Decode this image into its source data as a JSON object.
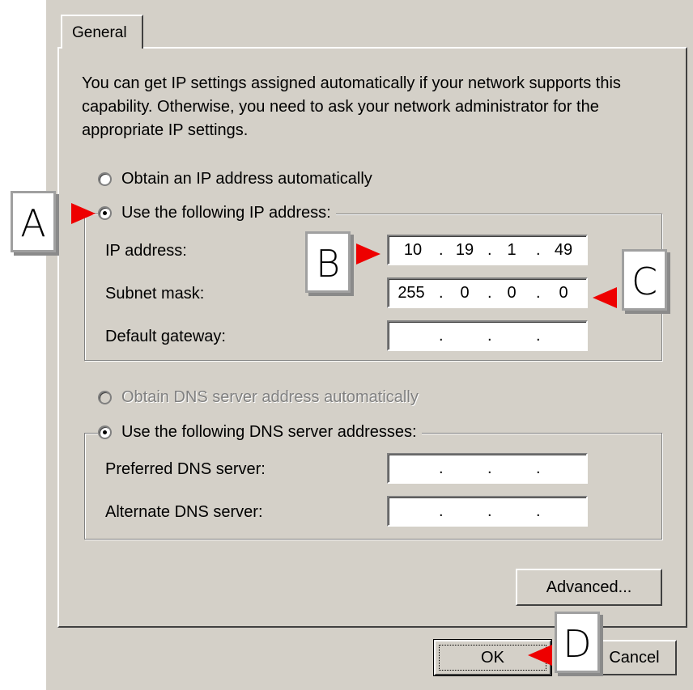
{
  "tab": {
    "label": "General"
  },
  "description": "You can get IP settings assigned automatically if your network supports this capability. Otherwise, you need to ask your network administrator for the appropriate IP settings.",
  "ip_section": {
    "auto_label": "Obtain an IP address automatically",
    "manual_label": "Use the following IP address:",
    "ip_label": "IP address:",
    "ip_value": [
      "10",
      "19",
      "1",
      "49"
    ],
    "subnet_label": "Subnet mask:",
    "subnet_value": [
      "255",
      "0",
      "0",
      "0"
    ],
    "gateway_label": "Default gateway:",
    "gateway_value": [
      "",
      "",
      "",
      ""
    ]
  },
  "dns_section": {
    "auto_label": "Obtain DNS server address automatically",
    "manual_label": "Use the following DNS server addresses:",
    "preferred_label": "Preferred DNS server:",
    "alternate_label": "Alternate DNS server:"
  },
  "buttons": {
    "advanced": "Advanced...",
    "ok": "OK",
    "cancel": "Cancel"
  },
  "callouts": {
    "a": "A",
    "b": "B",
    "c": "C",
    "d": "D"
  },
  "colors": {
    "dialog_bg": "#d4d0c8",
    "callout_arrow": "#ee0000"
  }
}
